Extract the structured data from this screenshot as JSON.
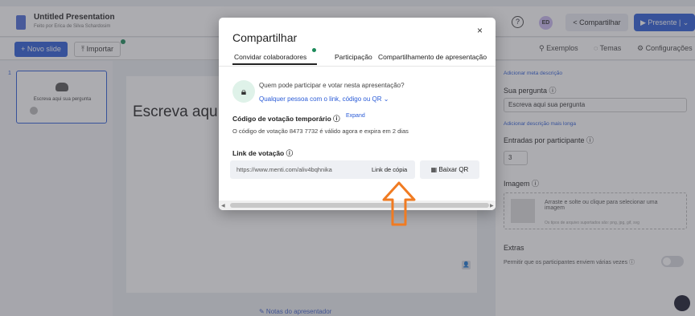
{
  "header": {
    "title": "Untitled Presentation",
    "subtitle": "Feito por Erica de Silva Schardosim",
    "help_icon": "?",
    "avatar_initials": "ED",
    "share_label": "< Compartilhar",
    "present_label": "▶ Presente  |  ⌄"
  },
  "toolbar": {
    "new_slide_label": "+ Novo slide",
    "import_label": "⤒ Importar",
    "examples_label": "⚲ Exemplos",
    "themes_label": "◌ Temas",
    "settings_label": "⚙ Configurações"
  },
  "slides": {
    "number": "1",
    "thumb_text": "Escreva aqui sua pergunta"
  },
  "canvas": {
    "question_text": "Escreva aqu",
    "notes_label": "✎ Notas do apresentador"
  },
  "right_panel": {
    "add_meta_link": "Adicionar meta descrição",
    "question_label": "Sua pergunta ⓘ",
    "question_value": "Escreva aqui sua pergunta",
    "add_long_desc_link": "Adicionar descrição mais longa",
    "entries_label": "Entradas por participante ⓘ",
    "entries_value": "3",
    "image_label": "Imagem ⓘ",
    "image_drop_text": "Arraste e solte ou clique para selecionar uma imagem",
    "image_drop_sub": "Os tipos de arquivo suportados são: png, jpg, gif, svg",
    "extras_label": "Extras",
    "extras_option": "Permitir que os participantes enviem várias vezes ⓘ"
  },
  "modal": {
    "title": "Compartilhar",
    "close_label": "×",
    "tabs": [
      {
        "label": "Convidar colaboradores"
      },
      {
        "label": "Participação"
      },
      {
        "label": "Compartilhamento de apresentação"
      }
    ],
    "access_question": "Quem pode participar e votar nesta apresentação?",
    "access_value": "Qualquer pessoa com o link, código ou QR ⌄",
    "code_title": "Código de votação temporário ⓘ",
    "expand_label": "Expand",
    "code_text": "O código de votação 8473 7732 é válido agora e expira em 2 dias",
    "link_title": "Link de votação ⓘ",
    "link_url": "https://www.menti.com/aliv4bqhnika",
    "copy_label": "Link de cópia",
    "qr_label": "▦ Baixar QR"
  },
  "colors": {
    "accent": "#2a5bd7",
    "annotation_arrow": "#f07b22",
    "lock_bg": "#dff2e9"
  }
}
